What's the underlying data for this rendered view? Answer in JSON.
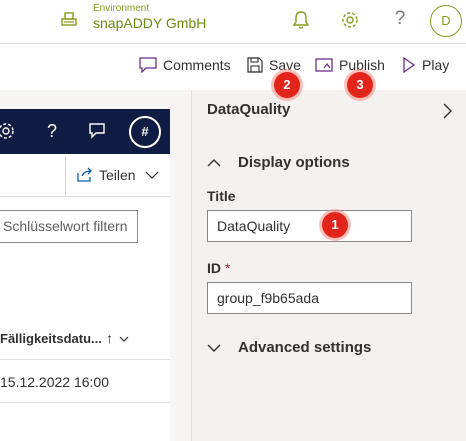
{
  "header": {
    "environment_label": "Environment",
    "environment_name": "snapADDY GmbH",
    "avatar_initial": "D",
    "icons": [
      "environment-icon",
      "bell-icon",
      "gear-icon",
      "help-icon"
    ],
    "help_glyph": "?"
  },
  "command_bar": {
    "comments_label": "Comments",
    "save_label": "Save",
    "publish_label": "Publish",
    "play_label": "Play"
  },
  "left_app": {
    "hash_label": "#",
    "help_glyph": "?",
    "share_label": "Teilen",
    "filter_placeholder": "Schlüsselwort filtern",
    "column_header": "Fälligkeitsdatu...",
    "sort_glyph": "↑",
    "rows": [
      {
        "due_date": "15.12.2022 16:00"
      }
    ]
  },
  "panel": {
    "title": "DataQuality",
    "display_options_label": "Display options",
    "title_field_label": "Title",
    "title_field_value": "DataQuality",
    "id_field_label": "ID",
    "id_required_mark": "*",
    "id_field_value": "group_f9b65ada",
    "advanced_settings_label": "Advanced settings"
  },
  "annotations": {
    "badge_1": "1",
    "badge_2": "2",
    "badge_3": "3",
    "badge_color": "#e3241b"
  },
  "colors": {
    "environment_accent": "#6b8b0f",
    "dark_bar": "#0f1d44",
    "panel_background": "#f3f2f1",
    "command_icon": "#6b2f8a"
  }
}
